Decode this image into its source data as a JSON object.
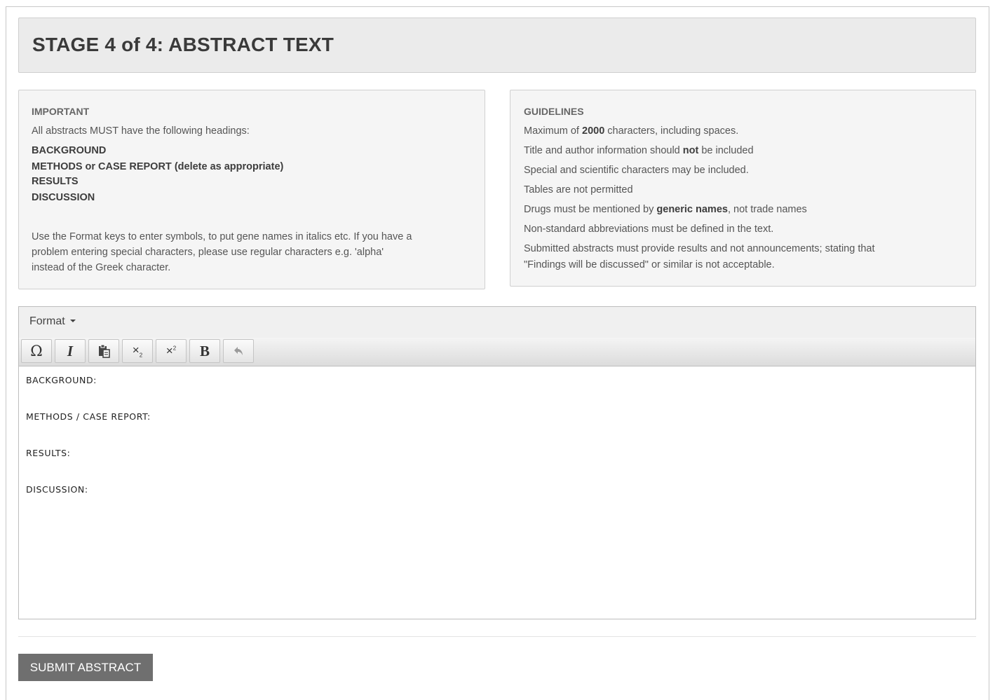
{
  "header": {
    "title": "STAGE 4 of 4: ABSTRACT TEXT"
  },
  "important": {
    "heading": "IMPORTANT",
    "intro": "All abstracts MUST have the following headings:",
    "headings": [
      "BACKGROUND",
      "METHODS or CASE REPORT (delete as appropriate)",
      "RESULTS",
      "DISCUSSION"
    ],
    "note_lines": [
      "Use the Format keys to enter symbols, to put gene names in italics etc. If you have a",
      "problem entering special characters, please use regular characters e.g. 'alpha'",
      "instead of the Greek character."
    ]
  },
  "guidelines": {
    "heading": "GUIDELINES",
    "max_pre": "Maximum of ",
    "max_num": "2000",
    "max_post": " characters, including spaces.",
    "title_pre": "Title and author information should ",
    "title_bold": "not",
    "title_post": " be included",
    "special": "Special and scientific characters may be included.",
    "tables": "Tables are not permitted",
    "drugs_pre": "Drugs must be mentioned by ",
    "drugs_bold": "generic names",
    "drugs_post": ", not trade names",
    "abbrev": "Non-standard abbreviations must be defined in the text.",
    "submitted_lines": [
      "Submitted abstracts must provide results and not announcements; stating that",
      "\"Findings will be discussed\" or similar is not acceptable."
    ]
  },
  "editor": {
    "menu_format": "Format",
    "toolbar": {
      "omega": "Ω",
      "italic": "I",
      "subscript_base": "×",
      "subscript_sup": "2",
      "superscript_base": "×",
      "superscript_sup": "2",
      "bold": "B"
    },
    "content_lines": [
      "BACKGROUND:",
      "METHODS / CASE REPORT:",
      "RESULTS:",
      "DISCUSSION:"
    ]
  },
  "submit": {
    "label": "SUBMIT ABSTRACT"
  }
}
